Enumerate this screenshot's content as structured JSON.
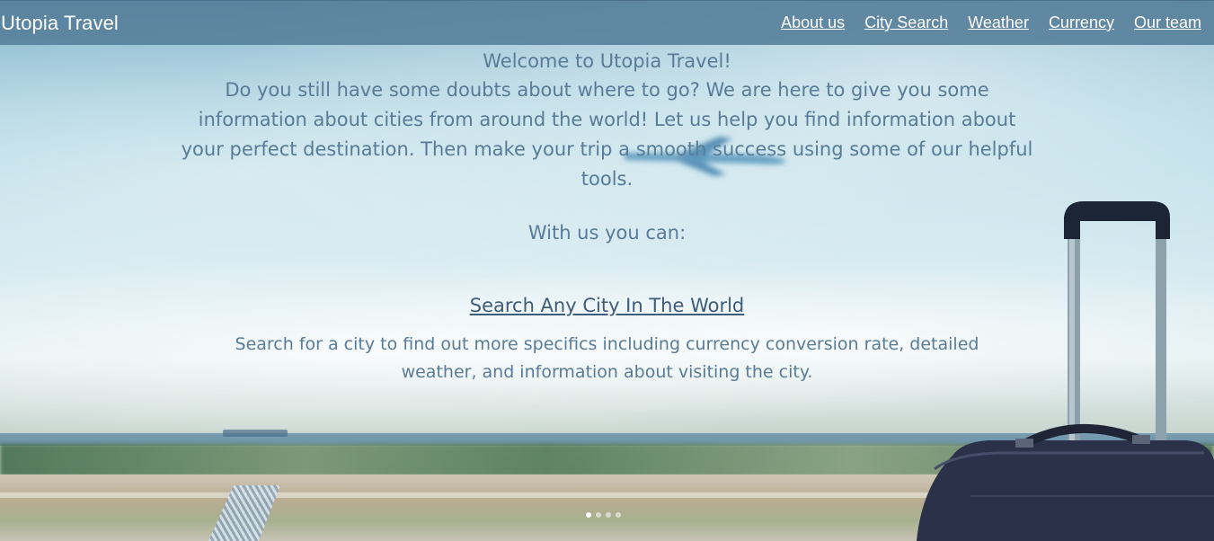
{
  "navbar": {
    "brand": "Utopia Travel",
    "links": [
      {
        "label": "About us"
      },
      {
        "label": "City Search"
      },
      {
        "label": "Weather"
      },
      {
        "label": "Currency"
      },
      {
        "label": "Our team"
      }
    ]
  },
  "main": {
    "welcome": "Welcome to Utopia Travel!",
    "intro": "Do you still have some doubts about where to go? We are here to give you some information about cities from around the world! Let us help you find information about your perfect destination. Then make your trip a smooth success using some of our helpful tools.",
    "with_us": "With us you can:",
    "feature": {
      "title": "Search Any City In The World",
      "description": "Search for a city to find out more specifics including currency conversion rate, detailed weather, and information about visiting the city."
    }
  },
  "carousel": {
    "slide_count": 4,
    "active_index": 0
  },
  "colors": {
    "navbar_bg": "#547d99",
    "text": "#587b97",
    "feature_title": "#3e5c78"
  }
}
